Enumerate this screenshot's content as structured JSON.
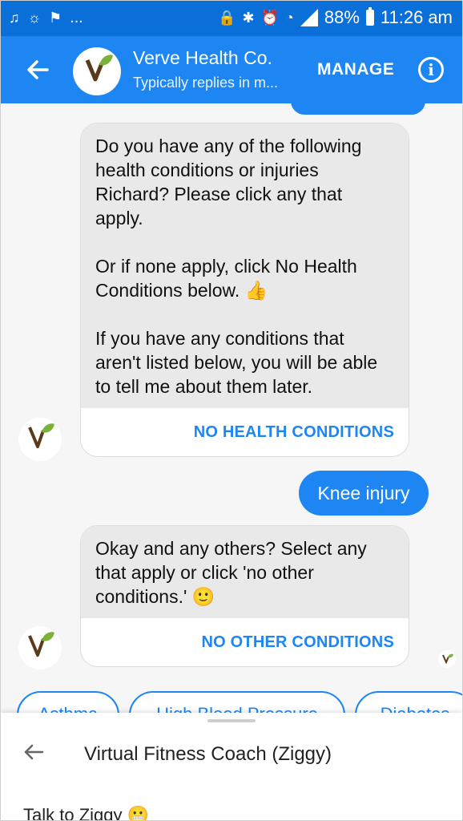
{
  "status_bar": {
    "left_icons": [
      "music-note-icon",
      "weather-icon",
      "check-flag-icon"
    ],
    "more": "...",
    "battery": "88%",
    "time": "11:26 am"
  },
  "header": {
    "title": "Verve Health Co.",
    "subtitle": "Typically replies in m...",
    "manage_label": "MANAGE",
    "info_label": "i",
    "logo_text": "Verve Health Co"
  },
  "messages": {
    "bot1_text": "Do you have any of the following health conditions or injuries Richard? Please click any that apply.\n\nOr if none apply, click No Health Conditions below. 👍\n\nIf you have any conditions that aren't listed below, you will be able to tell me about them later.",
    "bot1_action": "NO HEALTH CONDITIONS",
    "user1_text": "Knee injury",
    "bot2_text": "Okay and any others? Select any that apply or click 'no other conditions.' 🙂",
    "bot2_action": "NO OTHER CONDITIONS",
    "avatar_text": "Verve Health Co"
  },
  "quick_replies": [
    "Asthma",
    "High Blood Pressure",
    "Diabetes"
  ],
  "menu": {
    "title": "Virtual Fitness Coach (Ziggy)",
    "item1": "Talk to Ziggy 😬"
  },
  "colors": {
    "status_bar": "#0a6fd8",
    "app_bar": "#1e86f2",
    "accent": "#1e86f2",
    "bubble_gray": "#e9e9e9"
  }
}
